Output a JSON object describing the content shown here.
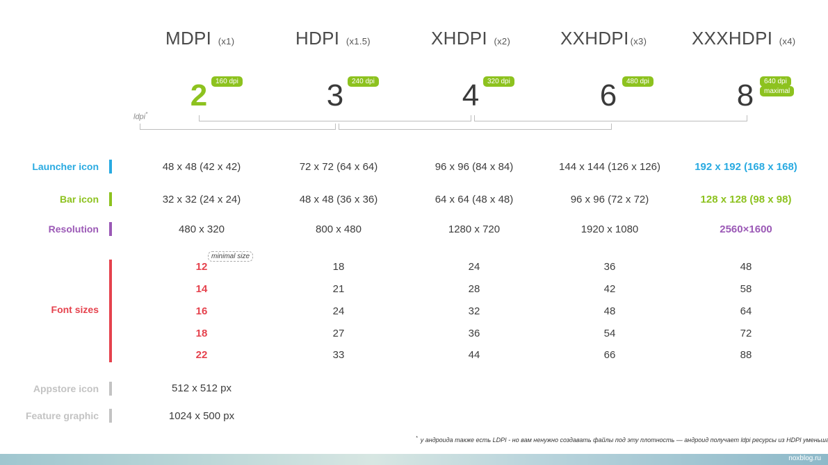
{
  "densities": [
    {
      "name": "MDPI",
      "mult": "(x1)",
      "num": "2",
      "dpi": "160 dpi"
    },
    {
      "name": "HDPI",
      "mult": "(x1.5)",
      "num": "3",
      "dpi": "240 dpi"
    },
    {
      "name": "XHDPI",
      "mult": "(x2)",
      "num": "4",
      "dpi": "320 dpi"
    },
    {
      "name": "XXHDPI",
      "mult": "(x3)",
      "num": "6",
      "dpi": "480 dpi"
    },
    {
      "name": "XXXHDPI",
      "mult": "(x4)",
      "num": "8",
      "dpi": "640 dpi",
      "extra": "maximal"
    }
  ],
  "ldpi": "ldpi",
  "ldpi_mark": "*",
  "colors": {
    "green": "#8dc21f",
    "blue": "#29aae1",
    "purple": "#9b59b6",
    "red": "#e5424d",
    "gray": "#c3c3c3"
  },
  "rows": {
    "launcher": {
      "label": "Launcher icon",
      "values": [
        "48 x 48 (42 x 42)",
        "72 x 72 (64 x 64)",
        "96 x 96 (84 x 84)",
        "144 x 144 (126 x 126)",
        "192 x 192 (168 x 168)"
      ]
    },
    "bar": {
      "label": "Bar icon",
      "values": [
        "32 x 32 (24 x 24)",
        "48 x 48 (36 x 36)",
        "64 x 64 (48 x 48)",
        "96 x 96 (72 x 72)",
        "128 x 128 (98 x 98)"
      ]
    },
    "resolution": {
      "label": "Resolution",
      "values": [
        "480 x 320",
        "800 x 480",
        "1280 x 720",
        "1920 x 1080",
        "2560×1600"
      ]
    },
    "fonts": {
      "label": "Font sizes",
      "minimal": "minimal size",
      "columns": [
        [
          "12",
          "14",
          "16",
          "18",
          "22"
        ],
        [
          "18",
          "21",
          "24",
          "27",
          "33"
        ],
        [
          "24",
          "28",
          "32",
          "36",
          "44"
        ],
        [
          "36",
          "42",
          "48",
          "54",
          "66"
        ],
        [
          "48",
          "58",
          "64",
          "72",
          "88"
        ]
      ]
    },
    "appstore": {
      "label": "Appstore icon",
      "value": "512 x 512 px"
    },
    "feature": {
      "label": "Feature graphic",
      "value": "1024 x 500 px"
    }
  },
  "footnote_mark": "*",
  "footnote": "у андроида также есть LDPI - но вам ненужно создавать файлы под эту плотность — андроид получает ldpi ресурсы из HDPI уменьшая их вдвое",
  "site": "noxblog.ru"
}
